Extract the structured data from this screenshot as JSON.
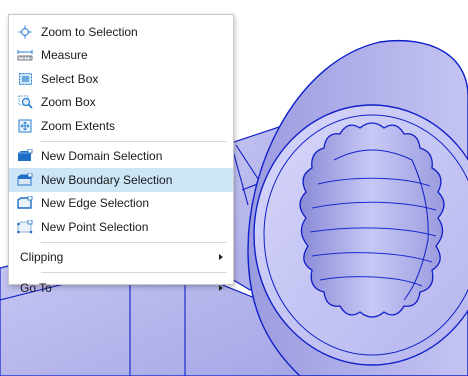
{
  "context_menu": {
    "items": [
      {
        "label": "Zoom to Selection",
        "icon": "zoom-to-selection-icon"
      },
      {
        "label": "Measure",
        "icon": "measure-icon"
      },
      {
        "label": "Select Box",
        "icon": "select-box-icon"
      },
      {
        "label": "Zoom Box",
        "icon": "zoom-box-icon"
      },
      {
        "label": "Zoom Extents",
        "icon": "zoom-extents-icon"
      },
      {
        "label": "New Domain Selection",
        "icon": "new-domain-selection-icon"
      },
      {
        "label": "New Boundary Selection",
        "icon": "new-boundary-selection-icon",
        "highlighted": true
      },
      {
        "label": "New Edge Selection",
        "icon": "new-edge-selection-icon"
      },
      {
        "label": "New Point Selection",
        "icon": "new-point-selection-icon"
      },
      {
        "label": "Clipping",
        "submenu": true
      },
      {
        "label": "Go To",
        "submenu": true
      }
    ]
  },
  "colors": {
    "model_fill": "#b2b2ee",
    "model_edge": "#1020c8",
    "highlight": "#cde6f7"
  }
}
